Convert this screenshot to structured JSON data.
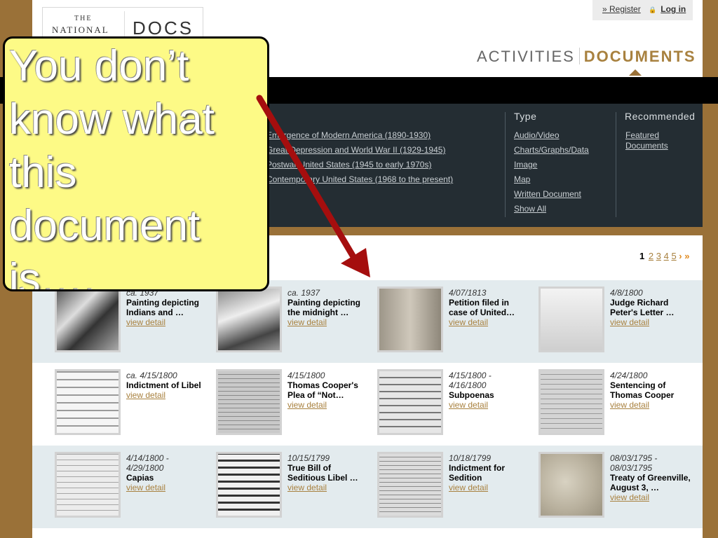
{
  "header": {
    "logo_the": "THE",
    "logo_national": "NATIONAL",
    "logo_docs": "DOCS",
    "register": "» Register",
    "login": "Log in",
    "nav_activities": "ACTIVITIES",
    "nav_documents": "DOCUMENTS"
  },
  "filters": {
    "eras": [
      "Emergence of Modern America (1890-1930)",
      "Great Depression and World War II (1929-1945)",
      "Postwar United States (1945 to early 1970s)",
      "Contemporary United States (1968 to the present)"
    ],
    "type_heading": "Type",
    "types": [
      "Audio/Video",
      "Charts/Graphs/Data",
      "Image",
      "Map",
      "Written Document",
      "Show All"
    ],
    "recommended_heading": "Recommended",
    "recommended_link": "Featured Documents"
  },
  "pager": {
    "current": "1",
    "pages": [
      "2",
      "3",
      "4",
      "5"
    ],
    "next": "›",
    "last": "»"
  },
  "results": [
    [
      {
        "date": "ca. 1937",
        "title": "Painting depicting Indians and …",
        "link": "view detail"
      },
      {
        "date": "ca. 1937",
        "title": "Painting depicting the midnight …",
        "link": "view detail"
      },
      {
        "date": "4/07/1813",
        "title": "Petition filed in case of United…",
        "link": "view detail"
      },
      {
        "date": "4/8/1800",
        "title": "Judge Richard Peter's Letter …",
        "link": "view detail"
      }
    ],
    [
      {
        "date": "ca. 4/15/1800",
        "title": "Indictment of Libel",
        "link": "view detail"
      },
      {
        "date": "4/15/1800",
        "title": "Thomas Cooper's Plea of “Not…",
        "link": "view detail"
      },
      {
        "date": "4/15/1800 - 4/16/1800",
        "title": "Subpoenas",
        "link": "view detail"
      },
      {
        "date": "4/24/1800",
        "title": "Sentencing of Thomas Cooper",
        "link": "view detail"
      }
    ],
    [
      {
        "date": "4/14/1800 - 4/29/1800",
        "title": "Capias",
        "link": "view detail"
      },
      {
        "date": "10/15/1799",
        "title": "True Bill of Seditious Libel …",
        "link": "view detail"
      },
      {
        "date": "10/18/1799",
        "title": "Indictment for Sedition",
        "link": "view detail"
      },
      {
        "date": "08/03/1795 - 08/03/1795",
        "title": "Treaty of Greenville, August 3, …",
        "link": "view detail"
      }
    ]
  ],
  "callout": {
    "text": "You don’t know what this document is…."
  },
  "colors": {
    "brand_brown": "#9a7138",
    "gold_link": "#a8813f",
    "panel_dark": "#242d33",
    "callout_yellow": "#fdfa86",
    "arrow_red": "#a50e0e"
  }
}
